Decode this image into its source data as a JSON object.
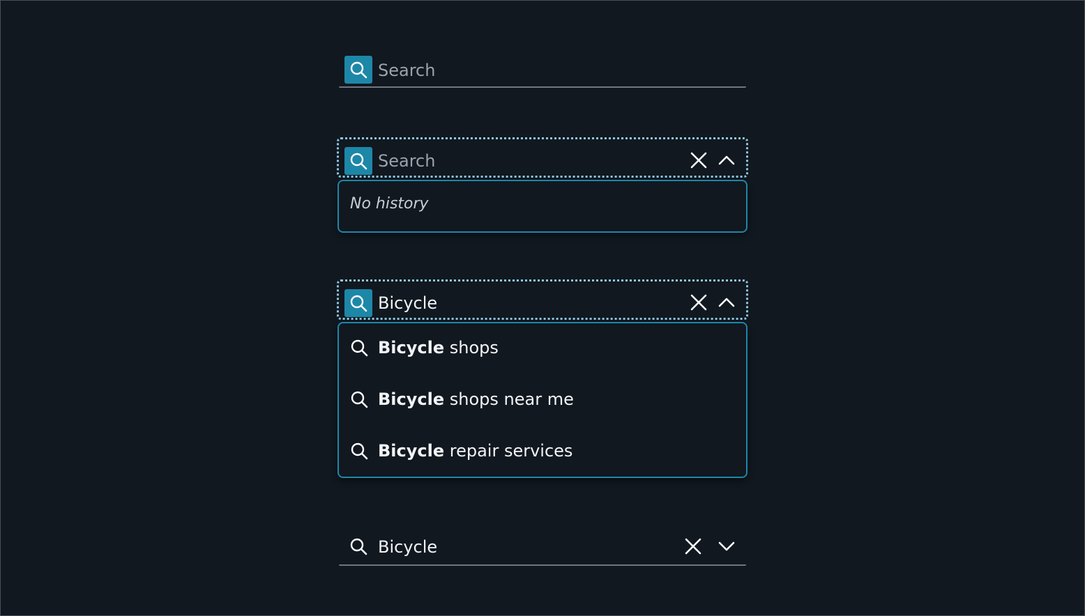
{
  "colors": {
    "background": "#111820",
    "accent": "#1d87a8",
    "focus_ring": "#8fc6de",
    "text": "#f2f4f6",
    "placeholder": "#9aa2ab",
    "underline": "#6f7780"
  },
  "icons": {
    "search": "search-icon",
    "clear": "close-icon",
    "collapse": "chevron-up-icon",
    "expand": "chevron-down-icon"
  },
  "search_default": {
    "placeholder": "Search",
    "value": ""
  },
  "search_focused_empty": {
    "placeholder": "Search",
    "value": "",
    "dropdown": {
      "empty_message": "No history"
    }
  },
  "search_focused_suggestions": {
    "value": "Bicycle",
    "dropdown": {
      "suggestions": [
        {
          "match": "Bicycle",
          "rest": " shops"
        },
        {
          "match": "Bicycle",
          "rest": " shops near me"
        },
        {
          "match": "Bicycle",
          "rest": " repair services"
        }
      ]
    }
  },
  "search_filled_collapsed": {
    "value": "Bicycle"
  }
}
